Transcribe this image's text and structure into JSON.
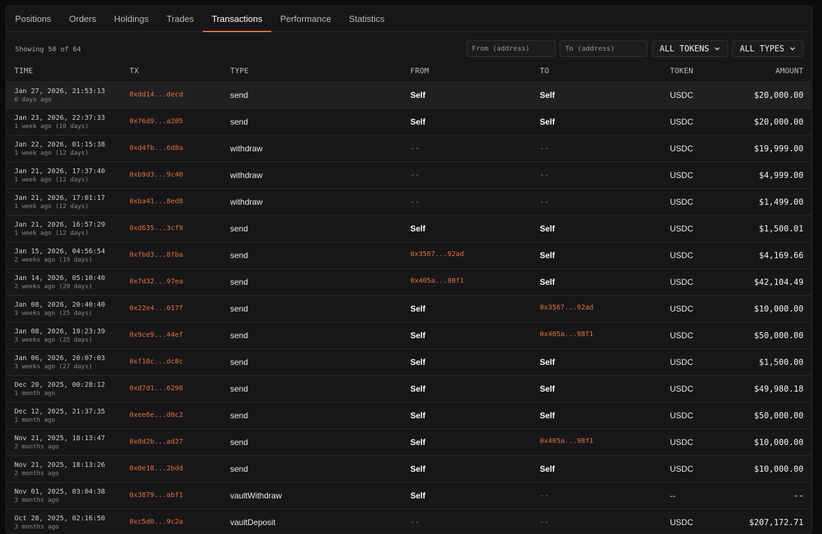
{
  "tabs": [
    "Positions",
    "Orders",
    "Holdings",
    "Trades",
    "Transactions",
    "Performance",
    "Statistics"
  ],
  "active_tab": 4,
  "toolbar": {
    "showing": "Showing 50 of 64",
    "from_placeholder": "From (address)",
    "to_placeholder": "To (address)",
    "tokens_label": "ALL TOKENS",
    "types_label": "ALL TYPES"
  },
  "columns": {
    "time": "TIME",
    "tx": "TX",
    "type": "TYPE",
    "from": "FROM",
    "to": "TO",
    "token": "TOKEN",
    "amount": "AMOUNT"
  },
  "colors": {
    "accent": "#e8733a",
    "background": "#17171a"
  },
  "rows": [
    {
      "time": "Jan 27, 2026, 21:53:13",
      "ago": "6 days ago",
      "tx": "0xdd14...decd",
      "type": "send",
      "from": "Self",
      "to": "Self",
      "token": "USDC",
      "amount": "$20,000.00"
    },
    {
      "time": "Jan 23, 2026, 22:37:33",
      "ago": "1 week ago (10 days)",
      "tx": "0x76d9...a205",
      "type": "send",
      "from": "Self",
      "to": "Self",
      "token": "USDC",
      "amount": "$20,000.00"
    },
    {
      "time": "Jan 22, 2026, 01:15:38",
      "ago": "1 week ago (12 days)",
      "tx": "0xd4fb...6d8a",
      "type": "withdraw",
      "from": "--",
      "to": "--",
      "token": "USDC",
      "amount": "$19,999.00"
    },
    {
      "time": "Jan 21, 2026, 17:37:40",
      "ago": "1 week ago (12 days)",
      "tx": "0xb9d3...9c40",
      "type": "withdraw",
      "from": "--",
      "to": "--",
      "token": "USDC",
      "amount": "$4,999.00"
    },
    {
      "time": "Jan 21, 2026, 17:01:17",
      "ago": "1 week ago (12 days)",
      "tx": "0xba41...8ed8",
      "type": "withdraw",
      "from": "--",
      "to": "--",
      "token": "USDC",
      "amount": "$1,499.00"
    },
    {
      "time": "Jan 21, 2026, 16:57:29",
      "ago": "1 week ago (12 days)",
      "tx": "0xd635...3cf9",
      "type": "send",
      "from": "Self",
      "to": "Self",
      "token": "USDC",
      "amount": "$1,500.01"
    },
    {
      "time": "Jan 15, 2026, 04:56:54",
      "ago": "2 weeks ago (19 days)",
      "tx": "0xfbd3...8fba",
      "type": "send",
      "from": "0x3567...92ad",
      "to": "Self",
      "token": "USDC",
      "amount": "$4,169.66"
    },
    {
      "time": "Jan 14, 2026, 05:10:40",
      "ago": "2 weeks ago (20 days)",
      "tx": "0x7d32...97ea",
      "type": "send",
      "from": "0x405a...98f1",
      "to": "Self",
      "token": "USDC",
      "amount": "$42,104.49"
    },
    {
      "time": "Jan 08, 2026, 20:40:40",
      "ago": "3 weeks ago (25 days)",
      "tx": "0x22e4...017f",
      "type": "send",
      "from": "Self",
      "to": "0x3567...92ad",
      "token": "USDC",
      "amount": "$10,000.00"
    },
    {
      "time": "Jan 08, 2026, 19:23:39",
      "ago": "3 weeks ago (25 days)",
      "tx": "0x9ce9...44ef",
      "type": "send",
      "from": "Self",
      "to": "0x405a...98f1",
      "token": "USDC",
      "amount": "$50,000.00"
    },
    {
      "time": "Jan 06, 2026, 20:07:03",
      "ago": "3 weeks ago (27 days)",
      "tx": "0xf10c...dc8c",
      "type": "send",
      "from": "Self",
      "to": "Self",
      "token": "USDC",
      "amount": "$1,500.00"
    },
    {
      "time": "Dec 20, 2025, 00:28:12",
      "ago": "1 month ago",
      "tx": "0xd7d1...6298",
      "type": "send",
      "from": "Self",
      "to": "Self",
      "token": "USDC",
      "amount": "$49,980.18"
    },
    {
      "time": "Dec 12, 2025, 21:37:35",
      "ago": "1 month ago",
      "tx": "0xee6e...d0c2",
      "type": "send",
      "from": "Self",
      "to": "Self",
      "token": "USDC",
      "amount": "$50,000.00"
    },
    {
      "time": "Nov 21, 2025, 18:13:47",
      "ago": "2 months ago",
      "tx": "0x0d2b...ad27",
      "type": "send",
      "from": "Self",
      "to": "0x405a...98f1",
      "token": "USDC",
      "amount": "$10,000.00"
    },
    {
      "time": "Nov 21, 2025, 18:13:26",
      "ago": "2 months ago",
      "tx": "0x0e18...2bdd",
      "type": "send",
      "from": "Self",
      "to": "Self",
      "token": "USDC",
      "amount": "$10,000.00"
    },
    {
      "time": "Nov 01, 2025, 03:04:38",
      "ago": "3 months ago",
      "tx": "0x3879...abf1",
      "type": "vaultWithdraw",
      "from": "Self",
      "to": "--",
      "token": "--",
      "amount": "--"
    },
    {
      "time": "Oct 28, 2025, 02:16:50",
      "ago": "3 months ago",
      "tx": "0xc5d0...9c2a",
      "type": "vaultDeposit",
      "from": "--",
      "to": "--",
      "token": "USDC",
      "amount": "$207,172.71"
    }
  ]
}
